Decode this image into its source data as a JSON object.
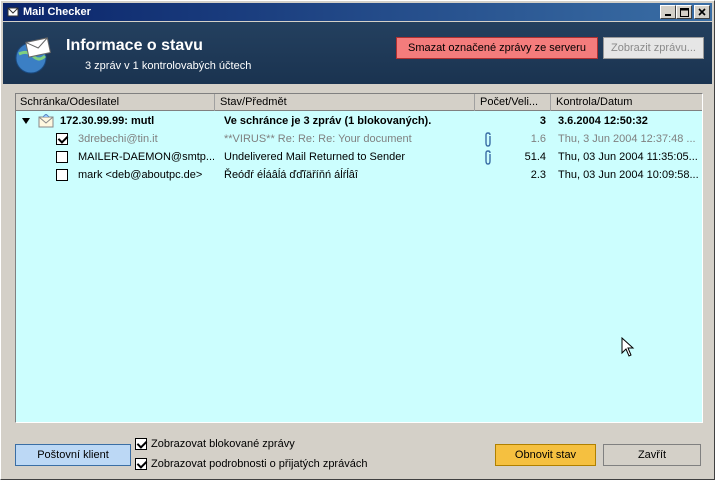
{
  "window": {
    "title": "Mail Checker",
    "buttons": [
      "_",
      "□",
      "X"
    ]
  },
  "header": {
    "title": "Informace o stavu",
    "subtitle": "3 zpráv v 1 kontrolovabých účtech",
    "delete_button": "Smazat označené zprávy ze serveru",
    "show_button": "Zobrazit zprávu...",
    "colors": {
      "header_bg": "#1e3a5f",
      "delete_bg": "#f47c7c",
      "list_bg": "#ccfefe"
    }
  },
  "list": {
    "columns": [
      "Schránka/Odesílatel",
      "Stav/Předmět",
      "Počet/Veli...",
      "Kontrola/Datum"
    ],
    "rows": [
      {
        "type": "account",
        "sender": "172.30.99.99: mutl",
        "subject": "Ve schránce je 3 zpráv (1 blokovaných).",
        "size": "3",
        "date": "3.6.2004 12:50:32",
        "style": "bold"
      },
      {
        "type": "message",
        "checked": true,
        "sender": "3drebechi@tin.it",
        "subject": "**VIRUS** Re: Re: Re: Your document",
        "attachment": true,
        "size": "1.6",
        "date": "Thu, 3 Jun 2004 12:37:48 ...",
        "style": "grey"
      },
      {
        "type": "message",
        "checked": false,
        "sender": "MAILER-DAEMON@smtp...",
        "subject": "Undelivered Mail Returned to Sender",
        "attachment": true,
        "size": "51.4",
        "date": "Thu, 03 Jun 2004 11:35:05...",
        "style": "normal"
      },
      {
        "type": "message",
        "checked": false,
        "sender": "mark <deb@aboutpc.de>",
        "subject": "Řeóđŕ éĺáâĺá  ďďĭäříňń  áĺŕĺâî",
        "attachment": false,
        "size": "2.3",
        "date": "Thu, 03 Jun 2004 10:09:58...",
        "style": "normal"
      }
    ]
  },
  "footer": {
    "client_button": "Poštovní klient",
    "option_blocked": "Zobrazovat blokované zprávy",
    "option_details": "Zobrazovat podrobnosti o přijatých zprávách",
    "option_blocked_checked": true,
    "option_details_checked": true,
    "refresh_button": "Obnovit stav",
    "close_button": "Zavřít"
  }
}
